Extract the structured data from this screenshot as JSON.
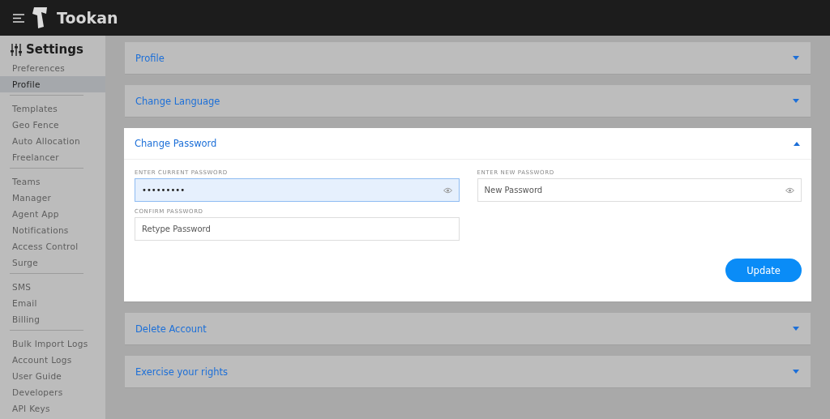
{
  "header": {
    "brand": "Tookan"
  },
  "sidebar": {
    "title": "Settings",
    "groups": [
      [
        {
          "label": "Preferences",
          "selected": false
        },
        {
          "label": "Profile",
          "selected": true
        }
      ],
      [
        {
          "label": "Templates",
          "selected": false
        },
        {
          "label": "Geo Fence",
          "selected": false
        },
        {
          "label": "Auto Allocation",
          "selected": false
        },
        {
          "label": "Freelancer",
          "selected": false
        }
      ],
      [
        {
          "label": "Teams",
          "selected": false
        },
        {
          "label": "Manager",
          "selected": false
        },
        {
          "label": "Agent App",
          "selected": false
        },
        {
          "label": "Notifications",
          "selected": false
        },
        {
          "label": "Access Control",
          "selected": false
        },
        {
          "label": "Surge",
          "selected": false
        }
      ],
      [
        {
          "label": "SMS",
          "selected": false
        },
        {
          "label": "Email",
          "selected": false
        },
        {
          "label": "Billing",
          "selected": false
        }
      ],
      [
        {
          "label": "Bulk Import Logs",
          "selected": false
        },
        {
          "label": "Account Logs",
          "selected": false
        },
        {
          "label": "User Guide",
          "selected": false
        },
        {
          "label": "Developers",
          "selected": false
        },
        {
          "label": "API Keys",
          "selected": false
        }
      ]
    ]
  },
  "sections": [
    {
      "title": "Profile",
      "expanded": false
    },
    {
      "title": "Change Language",
      "expanded": false
    },
    {
      "title": "Change Password",
      "expanded": true,
      "fields": [
        {
          "label": "ENTER CURRENT PASSWORD",
          "value": "•••••••••",
          "kind": "secret",
          "focused": true
        },
        {
          "label": "ENTER NEW PASSWORD",
          "placeholder": "New Password",
          "kind": "secret",
          "focused": false
        },
        {
          "label": "CONFIRM PASSWORD",
          "placeholder": "Retype Password",
          "kind": "plain",
          "focused": false
        }
      ],
      "button": "Update"
    },
    {
      "title": "Delete Account",
      "expanded": false
    },
    {
      "title": "Exercise your rights",
      "expanded": false
    }
  ]
}
